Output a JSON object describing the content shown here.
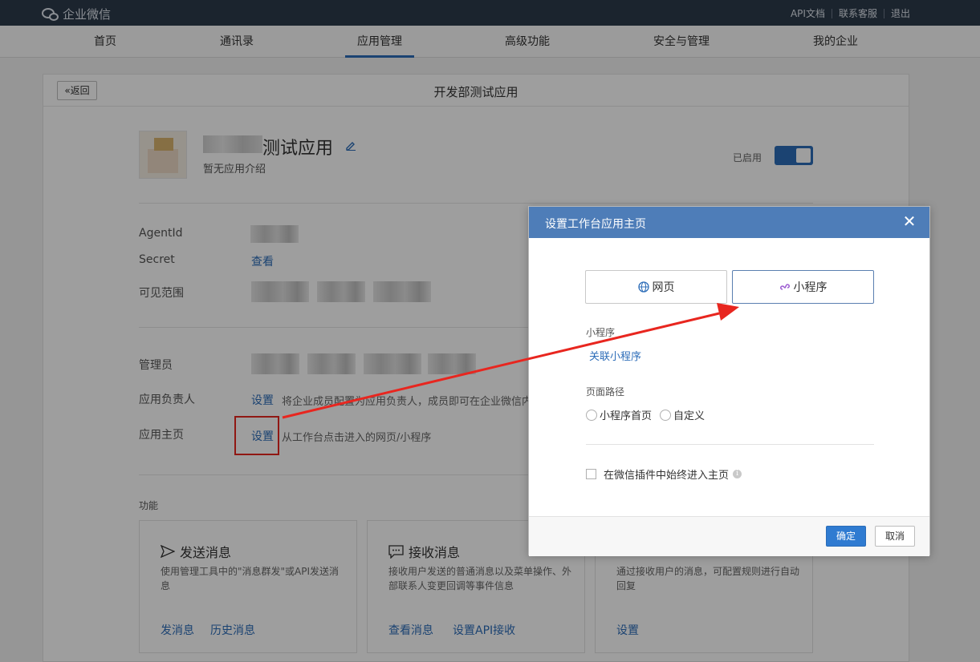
{
  "topbar": {
    "logo_text": "企业微信",
    "links": [
      "API文档",
      "联系客服",
      "退出"
    ]
  },
  "nav": {
    "items": [
      "首页",
      "通讯录",
      "应用管理",
      "高级功能",
      "安全与管理",
      "我的企业"
    ],
    "active": "应用管理"
  },
  "page": {
    "back_label": "«返回",
    "title": "开发部测试应用"
  },
  "app": {
    "name_suffix": "测试应用",
    "intro": "暂无应用介绍",
    "enabled_label": "已启用"
  },
  "fields": {
    "agentid_label": "AgentId",
    "secret_label": "Secret",
    "secret_link": "查看",
    "visibility_label": "可见范围",
    "admin_label": "管理员",
    "owner_label": "应用负责人",
    "owner_link": "设置",
    "owner_desc": "将企业成员配置为应用负责人，成员即可在企业微信内",
    "homepage_label": "应用主页",
    "homepage_link": "设置",
    "homepage_desc": "从工作台点击进入的网页/小程序"
  },
  "functions": {
    "section_label": "功能",
    "cards": [
      {
        "title": "发送消息",
        "desc": "使用管理工具中的\"消息群发\"或API发送消息",
        "links": [
          "发消息",
          "历史消息"
        ]
      },
      {
        "title": "接收消息",
        "desc": "接收用户发送的普通消息以及菜单操作、外部联系人变更回调等事件信息",
        "links": [
          "查看消息",
          "设置API接收"
        ]
      },
      {
        "title": "",
        "desc": "通过接收用户的消息，可配置规则进行自动回复",
        "links": [
          "设置"
        ]
      }
    ]
  },
  "modal": {
    "title": "设置工作台应用主页",
    "close": "✕",
    "type_web": "网页",
    "type_miniprogram": "小程序",
    "mp_label": "小程序",
    "mp_link": "关联小程序",
    "path_label": "页面路径",
    "radio_home": "小程序首页",
    "radio_custom": "自定义",
    "checkbox_label": "在微信插件中始终进入主页",
    "info": "i",
    "ok": "确定",
    "cancel": "取消"
  },
  "colors": {
    "topbar": "#2d3a4b",
    "accent": "#2d6db8",
    "modal_header": "#4e7db8",
    "annotation": "#e8261f"
  }
}
